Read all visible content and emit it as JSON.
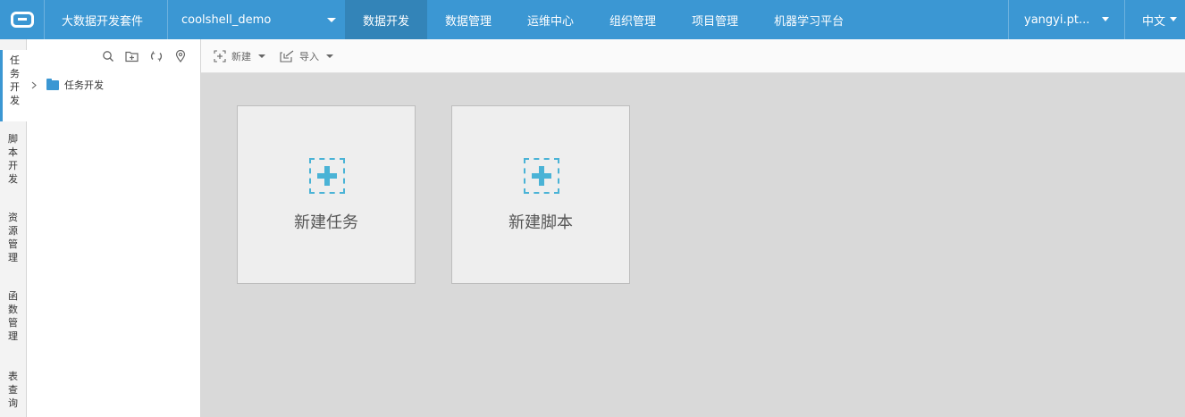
{
  "header": {
    "logo": "aliyun-logo",
    "suite": "大数据开发套件",
    "project": "coolshell_demo",
    "nav": [
      {
        "label": "数据开发",
        "active": true
      },
      {
        "label": "数据管理",
        "active": false
      },
      {
        "label": "运维中心",
        "active": false
      },
      {
        "label": "组织管理",
        "active": false
      },
      {
        "label": "项目管理",
        "active": false
      },
      {
        "label": "机器学习平台",
        "active": false
      }
    ],
    "user": "yangyi.pt...",
    "language": "中文"
  },
  "sidebar": {
    "tabs": [
      {
        "label": "任务开发",
        "active": true
      },
      {
        "label": "脚本开发",
        "active": false
      },
      {
        "label": "资源管理",
        "active": false
      },
      {
        "label": "函数管理",
        "active": false
      },
      {
        "label": "表查询",
        "active": false
      }
    ]
  },
  "tree": {
    "tools": [
      "search-icon",
      "new-folder-icon",
      "refresh-icon",
      "locate-icon"
    ],
    "root": {
      "label": "任务开发",
      "icon": "folder-icon"
    }
  },
  "toolbar": {
    "new_label": "新建",
    "import_label": "导入"
  },
  "cards": [
    {
      "label": "新建任务",
      "icon": "plus-icon"
    },
    {
      "label": "新建脚本",
      "icon": "plus-icon"
    }
  ],
  "colors": {
    "accent": "#3b97d3",
    "nav_active": "#3384b8",
    "card_icon": "#4ab3d6"
  }
}
